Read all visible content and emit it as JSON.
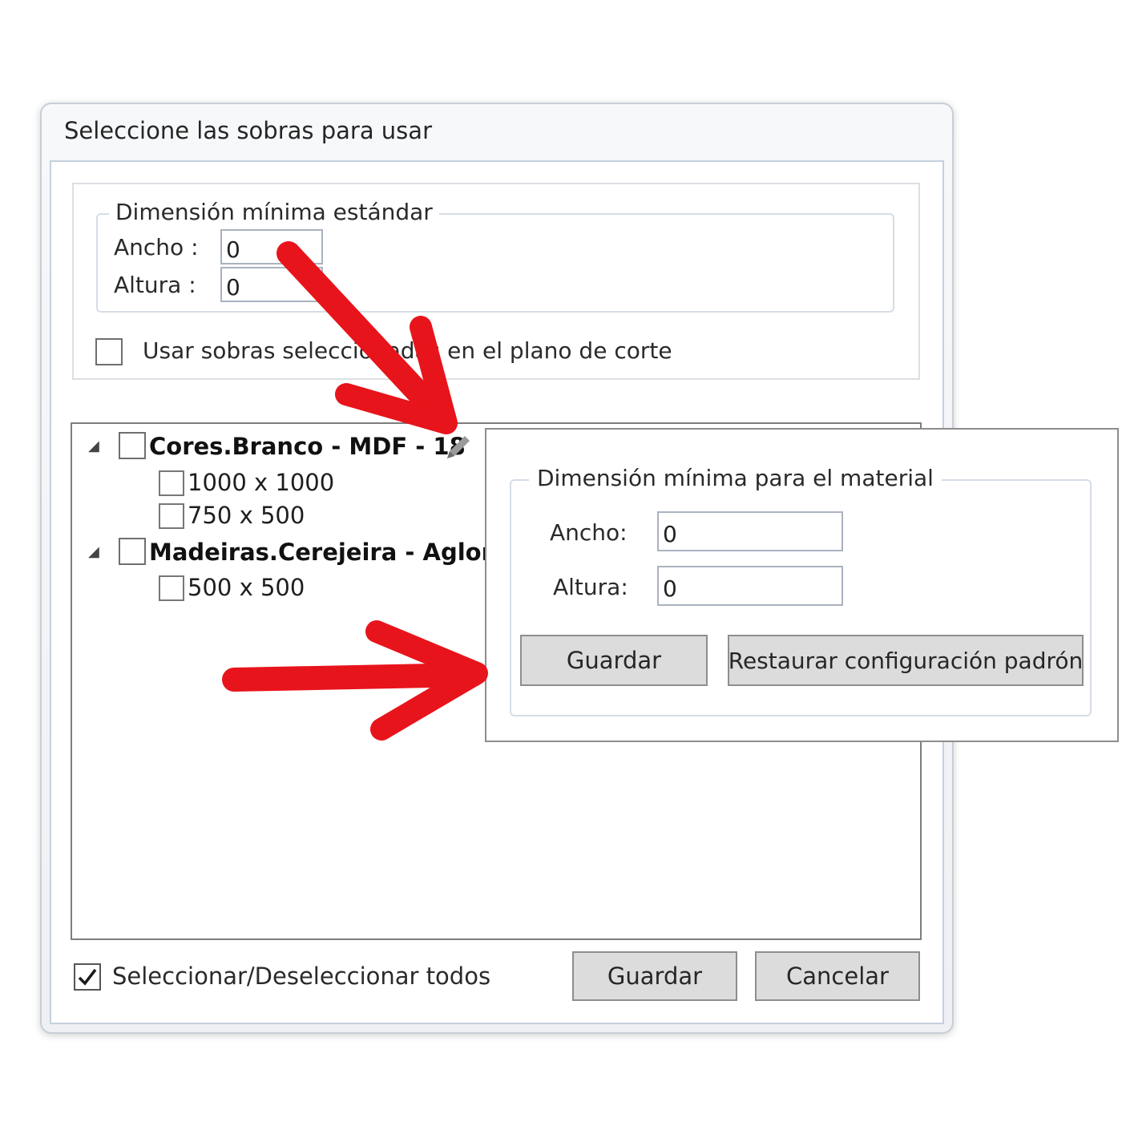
{
  "window": {
    "title": "Seleccione las sobras para usar"
  },
  "standard": {
    "legend": "Dimensión mínima estándar",
    "width_label": "Ancho :",
    "width_value": "0",
    "height_label": "Altura :",
    "height_value": "0",
    "use_selected_label": "Usar sobras seleccionadas en el plano de corte",
    "use_selected_checked": false
  },
  "tree": {
    "groups": [
      {
        "label": "Cores.Branco - MDF - 18",
        "checked": false,
        "expanded": true,
        "edit_icon": "pencil-icon",
        "items": [
          {
            "label": "1000 x 1000",
            "checked": false
          },
          {
            "label": "750 x 500",
            "checked": false
          }
        ]
      },
      {
        "label": "Madeiras.Cerejeira - Aglom -",
        "checked": false,
        "expanded": true,
        "items": [
          {
            "label": "500 x 500",
            "checked": false
          }
        ]
      }
    ]
  },
  "footer": {
    "select_all_label": "Seleccionar/Deseleccionar todos",
    "select_all_checked": true,
    "save_label": "Guardar",
    "cancel_label": "Cancelar"
  },
  "popup": {
    "legend": "Dimensión mínima para el material",
    "width_label": "Ancho:",
    "width_value": "0",
    "height_label": "Altura:",
    "height_value": "0",
    "save_label": "Guardar",
    "restore_label": "Restaurar configuración padrón"
  },
  "annotations": {
    "arrow_color": "#e8141b"
  }
}
